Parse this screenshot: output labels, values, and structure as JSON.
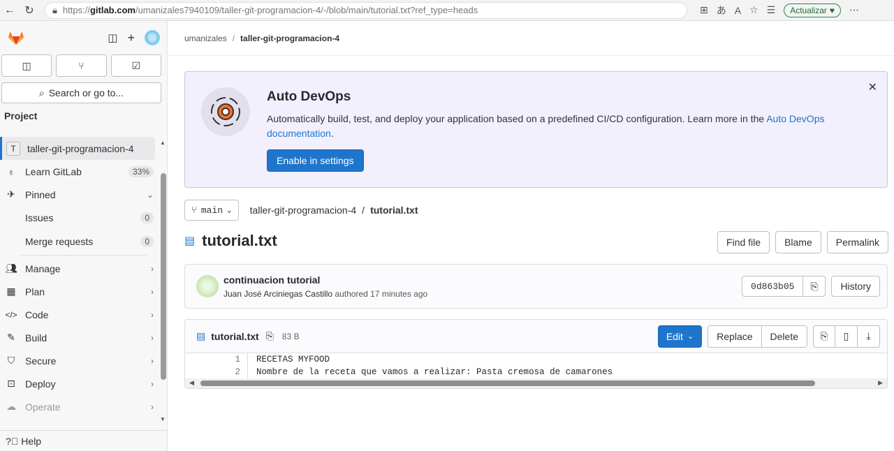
{
  "browser": {
    "url_prefix": "https://",
    "url_host": "gitlab.com",
    "url_path": "/umanizales7940109/taller-git-programacion-4/-/blob/main/tutorial.txt?ref_type=heads",
    "update_label": "Actualizar"
  },
  "sidebar": {
    "search_label": "Search or go to...",
    "section_title": "Project",
    "project_initial": "T",
    "items": [
      {
        "label": "taller-git-programacion-4"
      },
      {
        "label": "Learn GitLab",
        "badge": "33%"
      },
      {
        "label": "Pinned"
      },
      {
        "label": "Issues",
        "badge": "0"
      },
      {
        "label": "Merge requests",
        "badge": "0"
      },
      {
        "label": "Manage"
      },
      {
        "label": "Plan"
      },
      {
        "label": "Code"
      },
      {
        "label": "Build"
      },
      {
        "label": "Secure"
      },
      {
        "label": "Deploy"
      },
      {
        "label": "Operate"
      }
    ],
    "help_label": "Help"
  },
  "breadcrumb": {
    "owner": "umanizales",
    "separator": "/",
    "project": "taller-git-programacion-4"
  },
  "banner": {
    "title": "Auto DevOps",
    "text": "Automatically build, test, and deploy your application based on a predefined CI/CD configuration. Learn more in the ",
    "link_text": "Auto DevOps documentation",
    "text_end": ".",
    "button_label": "Enable in settings"
  },
  "repo": {
    "branch": "main",
    "path_project": "taller-git-programacion-4",
    "path_file": "tutorial.txt"
  },
  "file": {
    "title": "tutorial.txt",
    "actions": {
      "find_file": "Find file",
      "blame": "Blame",
      "permalink": "Permalink"
    }
  },
  "commit": {
    "message": "continuacion tutorial",
    "author": "Juan José Arciniegas Castillo",
    "meta": " authored 17 minutes ago",
    "sha": "0d863b05",
    "history_label": "History"
  },
  "blob": {
    "name": "tutorial.txt",
    "size": "83 B",
    "edit_label": "Edit",
    "replace_label": "Replace",
    "delete_label": "Delete",
    "lines": [
      {
        "n": "1",
        "text": "RECETAS MYFOOD"
      },
      {
        "n": "2",
        "text": "Nombre de la receta que vamos a realizar: Pasta cremosa de camarones"
      }
    ]
  },
  "colors": {
    "accent": "#1f75cb",
    "banner_bg": "#f3f0fd"
  }
}
